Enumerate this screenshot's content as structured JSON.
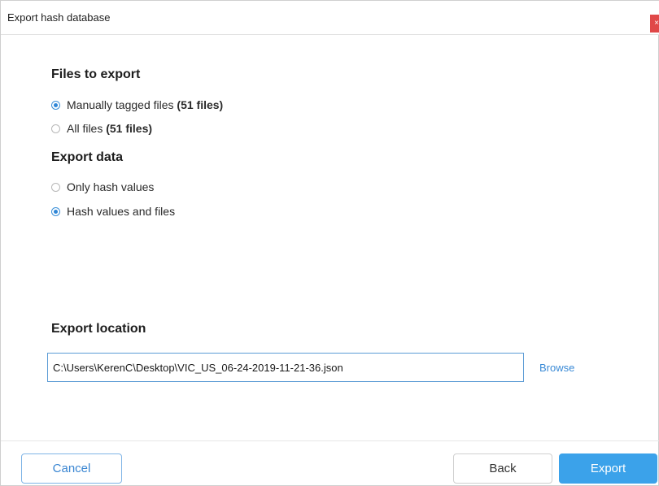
{
  "window": {
    "title": "Export hash database",
    "close_glyph": "×"
  },
  "files_section": {
    "heading": "Files to export",
    "options": [
      {
        "label": "Manually tagged files ",
        "count": "(51 files)",
        "selected": true
      },
      {
        "label": "All files ",
        "count": "(51 files)",
        "selected": false
      }
    ]
  },
  "data_section": {
    "heading": "Export data",
    "options": [
      {
        "label": "Only hash values",
        "selected": false
      },
      {
        "label": "Hash values and files",
        "selected": true
      }
    ]
  },
  "location_section": {
    "heading": "Export location",
    "path_value": "C:\\Users\\KerenC\\Desktop\\VIC_US_06-24-2019-11-21-36.json",
    "browse_label": "Browse"
  },
  "footer": {
    "cancel_label": "Cancel",
    "back_label": "Back",
    "export_label": "Export"
  },
  "colors": {
    "accent": "#3ba2ea",
    "link": "#3a8ad6",
    "close": "#e04848"
  }
}
